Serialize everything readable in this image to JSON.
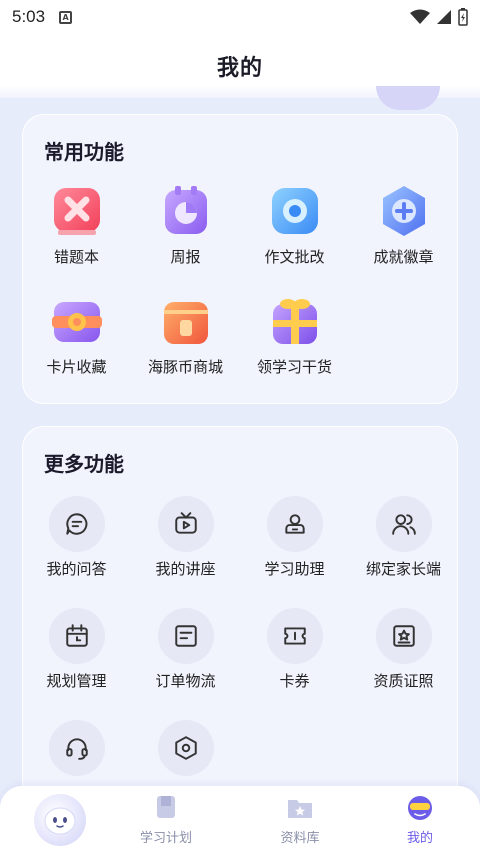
{
  "status_bar": {
    "time": "5:03",
    "notification_icon": "a-icon"
  },
  "header": {
    "title": "我的"
  },
  "common_section": {
    "title": "常用功能",
    "items": [
      {
        "label": "错题本",
        "icon": "wrong-questions-icon"
      },
      {
        "label": "周报",
        "icon": "weekly-report-icon"
      },
      {
        "label": "作文批改",
        "icon": "essay-correction-icon"
      },
      {
        "label": "成就徽章",
        "icon": "achievement-badge-icon"
      },
      {
        "label": "卡片收藏",
        "icon": "card-collection-icon"
      },
      {
        "label": "海豚币商城",
        "icon": "dolphin-coin-shop-icon"
      },
      {
        "label": "领学习干货",
        "icon": "gift-icon"
      }
    ]
  },
  "more_section": {
    "title": "更多功能",
    "items": [
      {
        "label": "我的问答",
        "icon": "chat-icon"
      },
      {
        "label": "我的讲座",
        "icon": "tv-icon"
      },
      {
        "label": "学习助理",
        "icon": "assistant-icon"
      },
      {
        "label": "绑定家长端",
        "icon": "users-icon"
      },
      {
        "label": "规划管理",
        "icon": "calendar-icon"
      },
      {
        "label": "订单物流",
        "icon": "order-icon"
      },
      {
        "label": "卡券",
        "icon": "ticket-icon"
      },
      {
        "label": "资质证照",
        "icon": "certificate-icon"
      },
      {
        "label": "",
        "icon": "headset-icon"
      },
      {
        "label": "",
        "icon": "settings-icon"
      }
    ]
  },
  "tabbar": {
    "tabs": [
      {
        "label": "学习计划",
        "icon": "book-icon"
      },
      {
        "label": "资料库",
        "icon": "star-folder-icon"
      },
      {
        "label": "我的",
        "icon": "profile-icon"
      }
    ]
  },
  "colors": {
    "accent": "#6c5ce7",
    "card_bg": "#f1f3fd",
    "page_bg": "#e7ecfb"
  }
}
